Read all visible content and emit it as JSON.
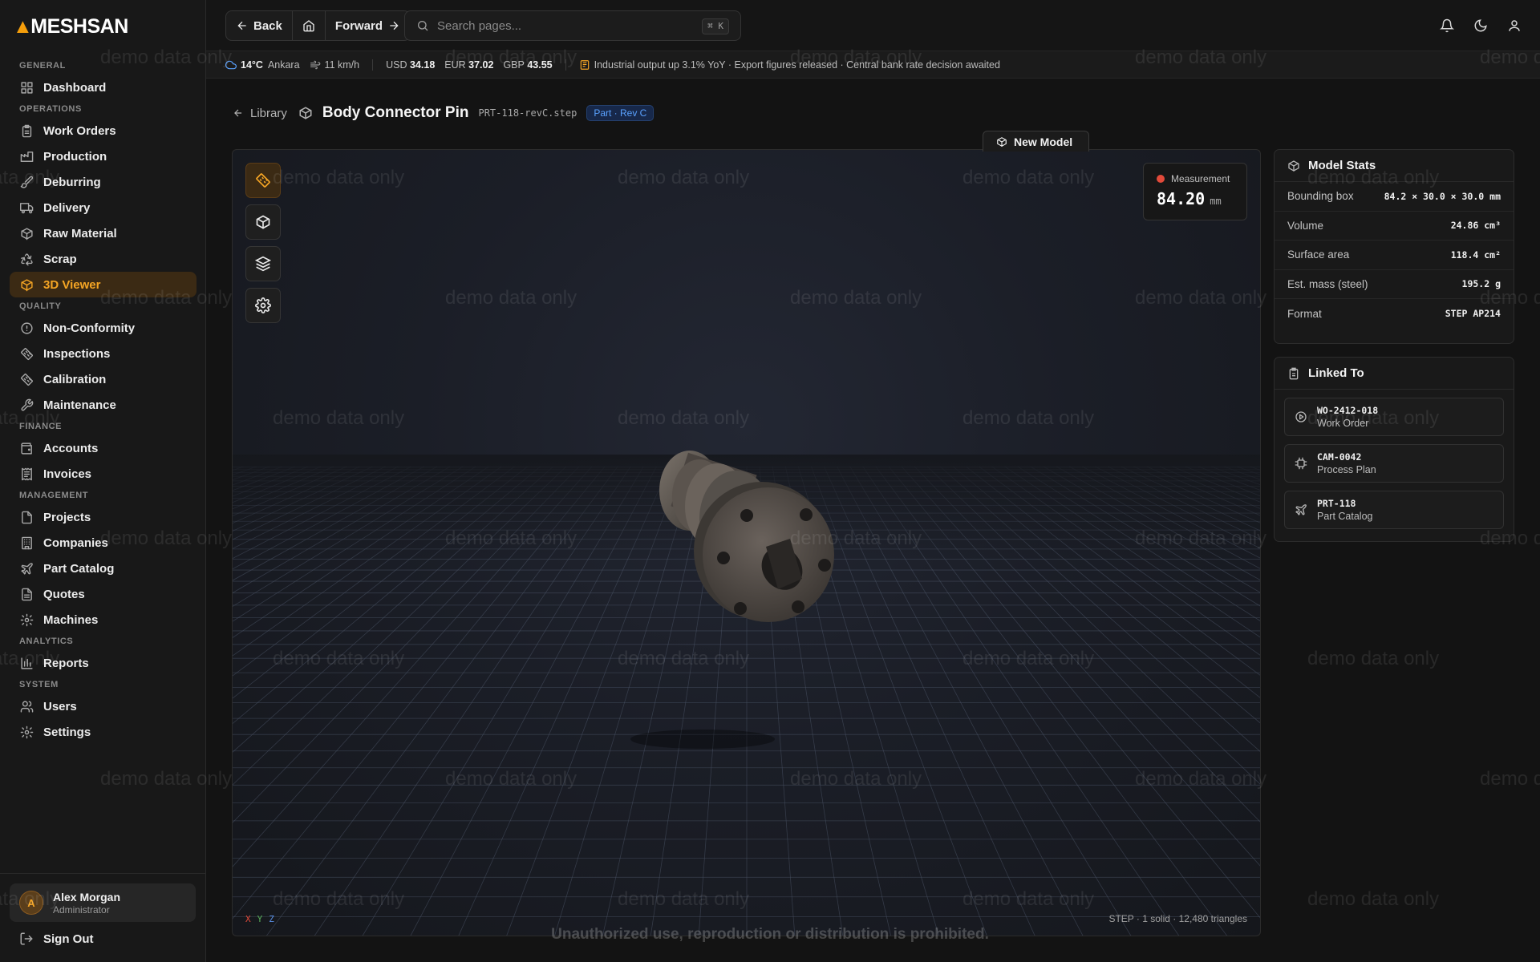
{
  "brand": {
    "name": "MESHSAN"
  },
  "sidebar": {
    "sections": [
      {
        "title": "GENERAL",
        "items": [
          {
            "label": "Dashboard",
            "icon": "dashboard-icon"
          }
        ]
      },
      {
        "title": "OPERATIONS",
        "items": [
          {
            "label": "Work Orders",
            "icon": "clipboard-icon"
          },
          {
            "label": "Production",
            "icon": "factory-icon"
          },
          {
            "label": "Deburring",
            "icon": "brush-icon"
          },
          {
            "label": "Delivery",
            "icon": "truck-icon"
          },
          {
            "label": "Raw Material",
            "icon": "box-icon"
          },
          {
            "label": "Scrap",
            "icon": "recycle-icon"
          },
          {
            "label": "3D Viewer",
            "icon": "cube-icon",
            "active": true
          }
        ]
      },
      {
        "title": "QUALITY",
        "items": [
          {
            "label": "Non-Conformity",
            "icon": "alert-circle-icon"
          },
          {
            "label": "Inspections",
            "icon": "ruler-icon"
          },
          {
            "label": "Calibration",
            "icon": "ruler-icon"
          },
          {
            "label": "Maintenance",
            "icon": "wrench-icon"
          }
        ]
      },
      {
        "title": "FINANCE",
        "items": [
          {
            "label": "Accounts",
            "icon": "wallet-icon"
          },
          {
            "label": "Invoices",
            "icon": "receipt-icon"
          }
        ]
      },
      {
        "title": "MANAGEMENT",
        "items": [
          {
            "label": "Projects",
            "icon": "file-icon"
          },
          {
            "label": "Companies",
            "icon": "building-icon"
          },
          {
            "label": "Part Catalog",
            "icon": "plane-icon"
          },
          {
            "label": "Quotes",
            "icon": "file-text-icon"
          },
          {
            "label": "Machines",
            "icon": "gear-icon"
          }
        ]
      },
      {
        "title": "ANALYTICS",
        "items": [
          {
            "label": "Reports",
            "icon": "bar-chart-icon"
          }
        ]
      },
      {
        "title": "SYSTEM",
        "items": [
          {
            "label": "Users",
            "icon": "users-icon"
          },
          {
            "label": "Settings",
            "icon": "gear-icon"
          }
        ]
      }
    ],
    "user": {
      "initial": "A",
      "name": "Alex Morgan",
      "role": "Administrator"
    },
    "sign_out": "Sign Out"
  },
  "topbar": {
    "back": "Back",
    "forward": "Forward",
    "search_placeholder": "Search pages...",
    "shortcut": "⌘ K"
  },
  "ticker": {
    "temp": "14°C",
    "city": "Ankara",
    "wind": "11 km/h",
    "usd_label": "USD",
    "usd": "34.18",
    "eur_label": "EUR",
    "eur": "37.02",
    "gbp_label": "GBP",
    "gbp": "43.55",
    "news": "Industrial output up 3.1% YoY · Export figures released · Central bank rate decision awaited"
  },
  "page": {
    "back_label": "Library",
    "title": "Body Connector Pin",
    "file": "PRT-118-revC.step",
    "badge": "Part · Rev C",
    "new_model": "New Model"
  },
  "viewer": {
    "measurement_label": "Measurement",
    "measurement_value": "84.20",
    "measurement_unit": "mm",
    "axes": [
      "X",
      "Y",
      "Z"
    ],
    "mesh_info": "STEP · 1 solid · 12,480 triangles"
  },
  "model_stats": {
    "title": "Model Stats",
    "rows": [
      {
        "key": "Bounding box",
        "value": "84.2 × 30.0 × 30.0 mm"
      },
      {
        "key": "Volume",
        "value": "24.86 cm³"
      },
      {
        "key": "Surface area",
        "value": "118.4 cm²"
      },
      {
        "key": "Est. mass (steel)",
        "value": "195.2 g"
      },
      {
        "key": "Format",
        "value": "STEP AP214"
      }
    ]
  },
  "linked_to": {
    "title": "Linked To",
    "items": [
      {
        "code": "WO-2412-018",
        "type": "Work Order",
        "icon": "play-circle-icon"
      },
      {
        "code": "CAM-0042",
        "type": "Process Plan",
        "icon": "chip-icon"
      },
      {
        "code": "PRT-118",
        "type": "Part Catalog",
        "icon": "plane-icon"
      }
    ]
  },
  "watermark": "demo data only",
  "legal_notice": "Unauthorized use, reproduction or distribution is prohibited.",
  "colors": {
    "accent": "#f5a524",
    "badge_blue": "#5aa2ff",
    "measure_dot": "#e24a3a"
  }
}
